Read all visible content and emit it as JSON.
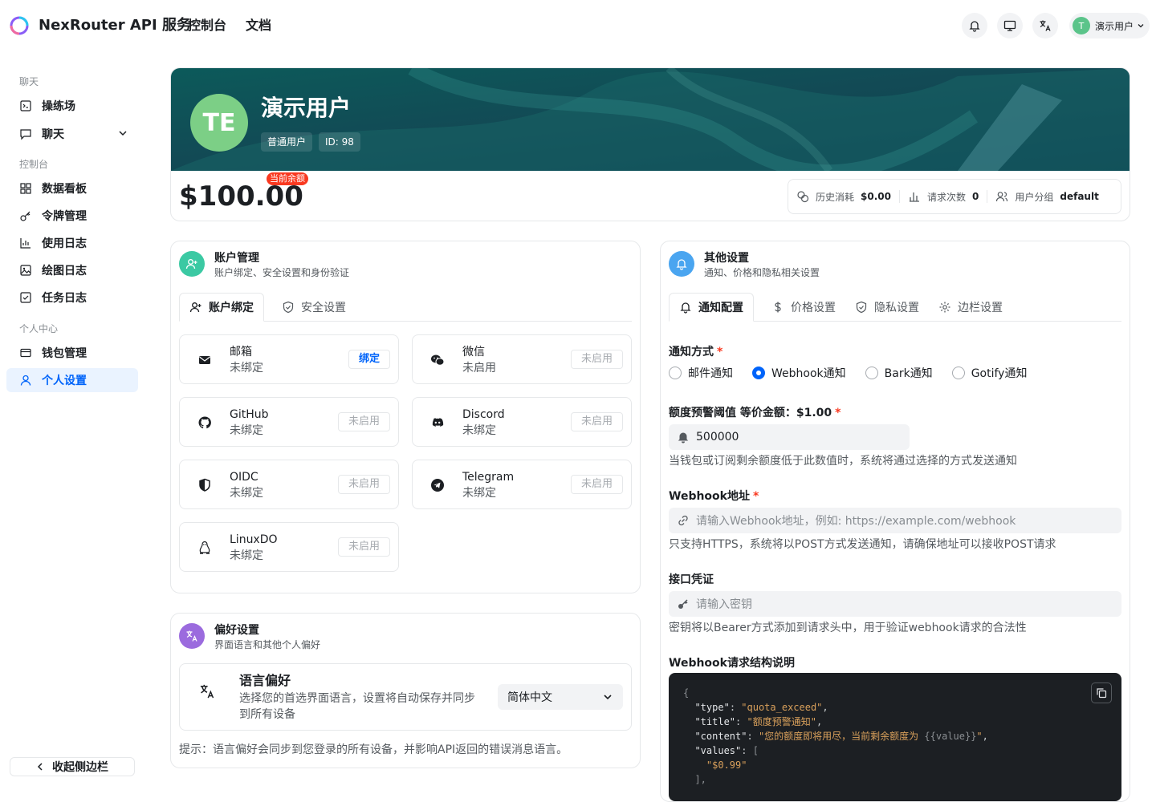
{
  "header": {
    "app_title": "NexRouter API 服务",
    "nav": [
      "控制台",
      "文档"
    ],
    "user_initial": "T",
    "user_name": "演示用户"
  },
  "sidebar": {
    "groups": [
      "聊天",
      "控制台",
      "个人中心"
    ],
    "items": [
      {
        "label": "操练场",
        "icon": "playground-icon"
      },
      {
        "label": "聊天",
        "icon": "chat-icon"
      },
      {
        "label": "数据看板",
        "icon": "dashboard-icon"
      },
      {
        "label": "令牌管理",
        "icon": "key-icon"
      },
      {
        "label": "使用日志",
        "icon": "bar-chart-icon"
      },
      {
        "label": "绘图日志",
        "icon": "image-icon"
      },
      {
        "label": "任务日志",
        "icon": "checklist-icon"
      },
      {
        "label": "钱包管理",
        "icon": "wallet-icon"
      },
      {
        "label": "个人设置",
        "icon": "user-icon"
      }
    ],
    "collapse_label": "收起侧边栏"
  },
  "profile": {
    "avatar_text": "TE",
    "name": "演示用户",
    "role": "普通用户",
    "id_label": "ID: 98",
    "balance": "$100.00",
    "balance_badge": "当前余额",
    "stats": [
      {
        "label": "历史消耗",
        "value": "$0.00"
      },
      {
        "label": "请求次数",
        "value": "0"
      },
      {
        "label": "用户分组",
        "value": "default"
      }
    ]
  },
  "account": {
    "title": "账户管理",
    "subtitle": "账户绑定、安全设置和身份验证",
    "tabs": [
      "账户绑定",
      "安全设置"
    ],
    "bindings": [
      {
        "name": "邮箱",
        "status": "未绑定",
        "action": "绑定"
      },
      {
        "name": "微信",
        "status": "未启用",
        "action": "未启用"
      },
      {
        "name": "GitHub",
        "status": "未绑定",
        "action": "未启用"
      },
      {
        "name": "Discord",
        "status": "未绑定",
        "action": "未启用"
      },
      {
        "name": "OIDC",
        "status": "未绑定",
        "action": "未启用"
      },
      {
        "name": "Telegram",
        "status": "未绑定",
        "action": "未启用"
      },
      {
        "name": "LinuxDO",
        "status": "未绑定",
        "action": "未启用"
      }
    ]
  },
  "preference": {
    "title": "偏好设置",
    "subtitle": "界面语言和其他个人偏好",
    "lang_title": "语言偏好",
    "lang_desc_1": "选择您的首选界面语言，设置将自动保存并同步",
    "lang_desc_2": "到所有设备",
    "lang_value": "简体中文",
    "tip": "提示：语言偏好会同步到您登录的所有设备，并影响API返回的错误消息语言。"
  },
  "other": {
    "title": "其他设置",
    "subtitle": "通知、价格和隐私相关设置",
    "tabs": [
      "通知配置",
      "价格设置",
      "隐私设置",
      "边栏设置"
    ],
    "notify_label": "通知方式",
    "notify_options": [
      "邮件通知",
      "Webhook通知",
      "Bark通知",
      "Gotify通知"
    ],
    "notify_selected": "Webhook通知",
    "threshold_label": "额度预警阈值 等价金额：$1.00",
    "threshold_value": "500000",
    "threshold_hint": "当钱包或订阅剩余额度低于此数值时，系统将通过选择的方式发送通知",
    "webhook_label": "Webhook地址",
    "webhook_placeholder": "请输入Webhook地址，例如: https://example.com/webhook",
    "webhook_hint": "只支持HTTPS，系统将以POST方式发送通知，请确保地址可以接收POST请求",
    "secret_label": "接口凭证",
    "secret_placeholder": "请输入密钥",
    "secret_hint": "密钥将以Bearer方式添加到请求头中，用于验证webhook请求的合法性",
    "struct_label": "Webhook请求结构说明",
    "code": {
      "open": "{",
      "type_key": "\"type\"",
      "type_val": "\"quota_exceed\"",
      "title_key": "\"title\"",
      "title_val": "\"额度预警通知\"",
      "content_key": "\"content\"",
      "content_val": "\"您的额度即将用尽，当前剩余额度为 ",
      "content_var": "{{value}}",
      "content_end": "\"",
      "values_key": "\"values\"",
      "values_open": "[",
      "values_item": "\"$0.99\"",
      "values_close": "],"
    }
  },
  "colors": {
    "primary": "#0064fa",
    "danger": "#f93920",
    "avatar": "#7ccf86"
  }
}
